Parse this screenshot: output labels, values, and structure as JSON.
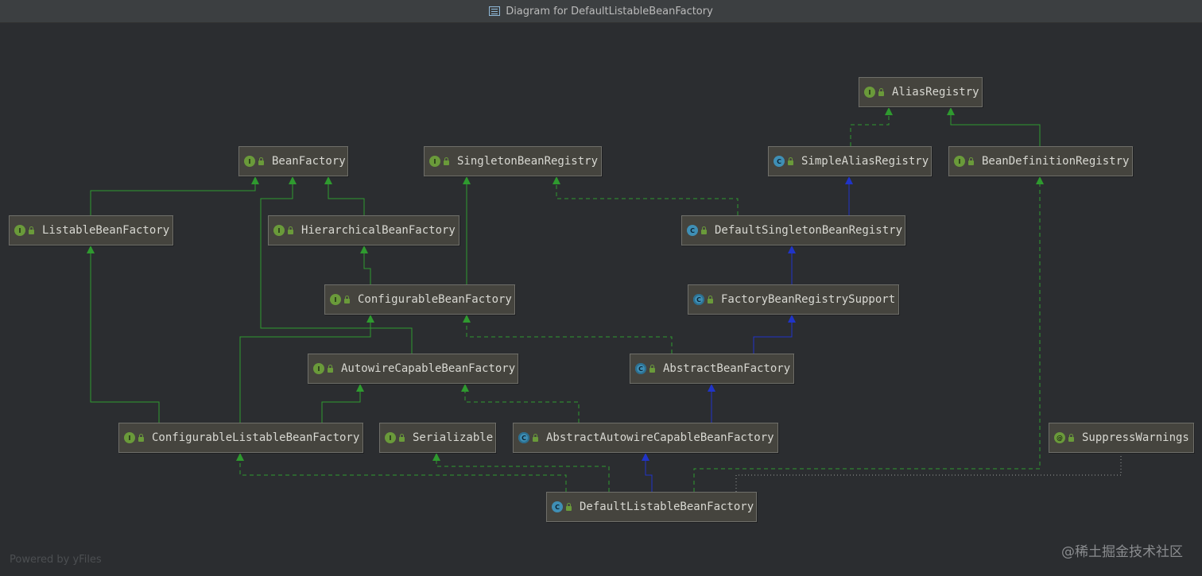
{
  "window": {
    "title": "Diagram for DefaultListableBeanFactory"
  },
  "footer": {
    "text": "Powered by yFiles"
  },
  "watermark": {
    "text": "@稀土掘金技术社区"
  },
  "colors": {
    "implements": "#2f9a2f",
    "extends": "#2034c8",
    "annotation": "#9a9a9a"
  },
  "nodes": [
    {
      "id": "AliasRegistry",
      "label": "AliasRegistry",
      "kind": "interface"
    },
    {
      "id": "BeanFactory",
      "label": "BeanFactory",
      "kind": "interface"
    },
    {
      "id": "SingletonBeanRegistry",
      "label": "SingletonBeanRegistry",
      "kind": "interface"
    },
    {
      "id": "SimpleAliasRegistry",
      "label": "SimpleAliasRegistry",
      "kind": "class"
    },
    {
      "id": "BeanDefinitionRegistry",
      "label": "BeanDefinitionRegistry",
      "kind": "interface"
    },
    {
      "id": "ListableBeanFactory",
      "label": "ListableBeanFactory",
      "kind": "interface"
    },
    {
      "id": "HierarchicalBeanFactory",
      "label": "HierarchicalBeanFactory",
      "kind": "interface"
    },
    {
      "id": "DefaultSingletonBeanRegistry",
      "label": "DefaultSingletonBeanRegistry",
      "kind": "class"
    },
    {
      "id": "ConfigurableBeanFactory",
      "label": "ConfigurableBeanFactory",
      "kind": "interface"
    },
    {
      "id": "FactoryBeanRegistrySupport",
      "label": "FactoryBeanRegistrySupport",
      "kind": "abstract"
    },
    {
      "id": "AutowireCapableBeanFactory",
      "label": "AutowireCapableBeanFactory",
      "kind": "interface"
    },
    {
      "id": "AbstractBeanFactory",
      "label": "AbstractBeanFactory",
      "kind": "abstract"
    },
    {
      "id": "ConfigurableListableBeanFactory",
      "label": "ConfigurableListableBeanFactory",
      "kind": "interface"
    },
    {
      "id": "Serializable",
      "label": "Serializable",
      "kind": "interface"
    },
    {
      "id": "AbstractAutowireCapableBeanFactory",
      "label": "AbstractAutowireCapableBeanFactory",
      "kind": "abstract"
    },
    {
      "id": "SuppressWarnings",
      "label": "SuppressWarnings",
      "kind": "annotation"
    },
    {
      "id": "DefaultListableBeanFactory",
      "label": "DefaultListableBeanFactory",
      "kind": "class"
    }
  ],
  "edges": [
    {
      "from": "ListableBeanFactory",
      "to": "BeanFactory",
      "type": "extends-interface"
    },
    {
      "from": "HierarchicalBeanFactory",
      "to": "BeanFactory",
      "type": "extends-interface"
    },
    {
      "from": "AutowireCapableBeanFactory",
      "to": "BeanFactory",
      "type": "extends-interface"
    },
    {
      "from": "ConfigurableBeanFactory",
      "to": "HierarchicalBeanFactory",
      "type": "extends-interface"
    },
    {
      "from": "ConfigurableBeanFactory",
      "to": "SingletonBeanRegistry",
      "type": "extends-interface"
    },
    {
      "from": "ConfigurableListableBeanFactory",
      "to": "ListableBeanFactory",
      "type": "extends-interface"
    },
    {
      "from": "ConfigurableListableBeanFactory",
      "to": "ConfigurableBeanFactory",
      "type": "extends-interface"
    },
    {
      "from": "ConfigurableListableBeanFactory",
      "to": "AutowireCapableBeanFactory",
      "type": "extends-interface"
    },
    {
      "from": "BeanDefinitionRegistry",
      "to": "AliasRegistry",
      "type": "extends-interface"
    },
    {
      "from": "SimpleAliasRegistry",
      "to": "AliasRegistry",
      "type": "implements"
    },
    {
      "from": "DefaultSingletonBeanRegistry",
      "to": "SimpleAliasRegistry",
      "type": "extends"
    },
    {
      "from": "DefaultSingletonBeanRegistry",
      "to": "SingletonBeanRegistry",
      "type": "implements"
    },
    {
      "from": "FactoryBeanRegistrySupport",
      "to": "DefaultSingletonBeanRegistry",
      "type": "extends"
    },
    {
      "from": "AbstractBeanFactory",
      "to": "FactoryBeanRegistrySupport",
      "type": "extends"
    },
    {
      "from": "AbstractBeanFactory",
      "to": "ConfigurableBeanFactory",
      "type": "implements"
    },
    {
      "from": "AbstractAutowireCapableBeanFactory",
      "to": "AbstractBeanFactory",
      "type": "extends"
    },
    {
      "from": "AbstractAutowireCapableBeanFactory",
      "to": "AutowireCapableBeanFactory",
      "type": "implements"
    },
    {
      "from": "DefaultListableBeanFactory",
      "to": "AbstractAutowireCapableBeanFactory",
      "type": "extends"
    },
    {
      "from": "DefaultListableBeanFactory",
      "to": "ConfigurableListableBeanFactory",
      "type": "implements"
    },
    {
      "from": "DefaultListableBeanFactory",
      "to": "Serializable",
      "type": "implements"
    },
    {
      "from": "DefaultListableBeanFactory",
      "to": "BeanDefinitionRegistry",
      "type": "implements"
    },
    {
      "from": "DefaultListableBeanFactory",
      "to": "SuppressWarnings",
      "type": "annotation"
    }
  ]
}
